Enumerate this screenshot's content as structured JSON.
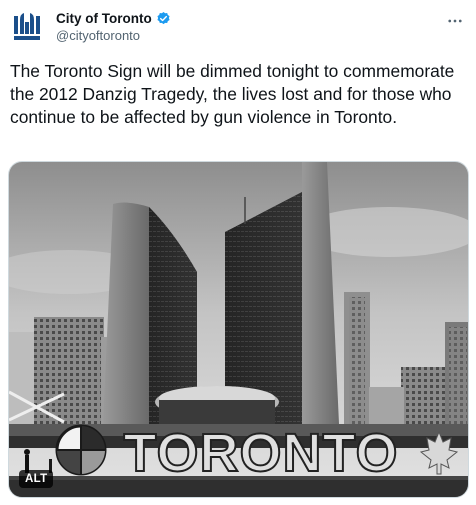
{
  "tweet": {
    "display_name": "City of Toronto",
    "handle": "@cityoftoronto",
    "text": "The Toronto Sign will be dimmed tonight to commemorate the 2012 Danzig Tragedy, the lives lost and for those who continue to be affected by gun violence in Toronto.",
    "avatar_icon": "city-of-toronto-logo-icon",
    "verified_icon": "verified-badge-icon",
    "more_icon": "more-options-icon"
  },
  "media": {
    "sign_text": "TORONTO",
    "alt_label": "ALT",
    "colors": {
      "verified": "#1d9bf0",
      "brand": "#1b4f8a"
    }
  }
}
